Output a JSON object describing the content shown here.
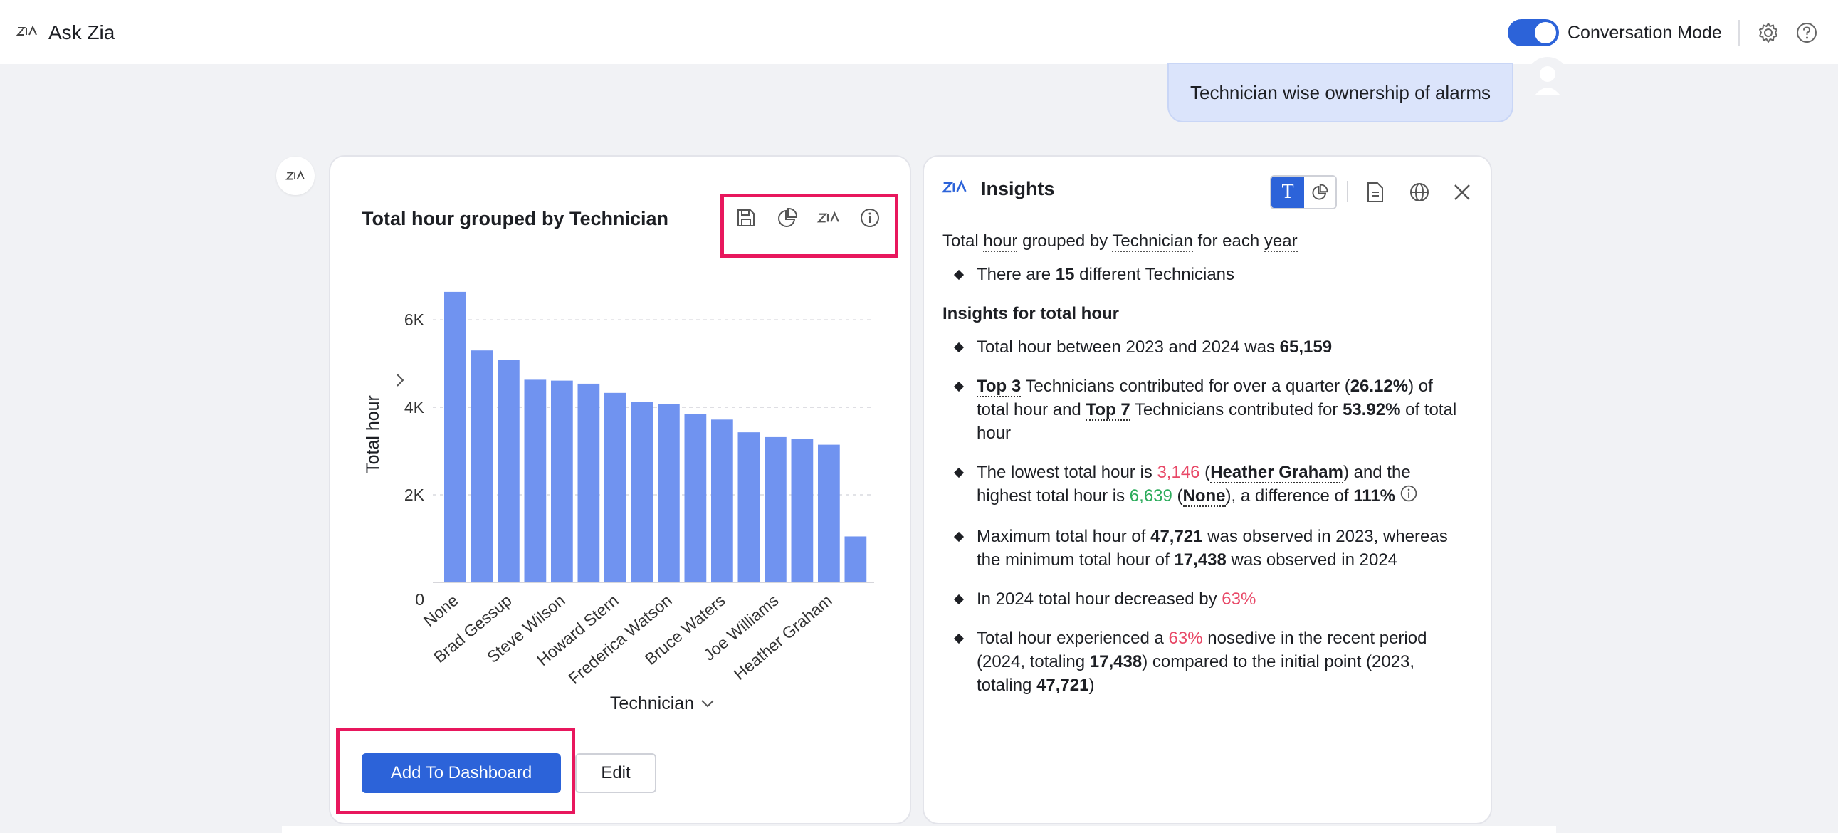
{
  "app": {
    "title": "Ask Zia",
    "mode_label": "Conversation Mode",
    "mode_on": true,
    "icons": {
      "brand": "zia-logo-icon",
      "settings": "gear-icon",
      "help": "help-icon"
    }
  },
  "conversation": {
    "user_message": "Technician wise ownership of alarms"
  },
  "chart_card": {
    "title": "Total hour grouped by Technician",
    "tools": [
      "save-icon",
      "pie-chart-icon",
      "zia-icon",
      "info-icon"
    ],
    "add_button": "Add To Dashboard",
    "edit_button": "Edit"
  },
  "chart_data": {
    "type": "bar",
    "xlabel": "Technician",
    "ylabel": "Total hour",
    "ylim": [
      0,
      6800
    ],
    "yticks": [
      0,
      2000,
      4000,
      6000
    ],
    "ytick_labels": [
      "0",
      "2K",
      "4K",
      "6K"
    ],
    "categories": [
      "None",
      "",
      "Brad Gessup",
      "",
      "Steve Wilson",
      "",
      "Howard Stern",
      "",
      "Frederica Watson",
      "",
      "Bruce Waters",
      "",
      "Joe Williams",
      "",
      "Heather Graham",
      ""
    ],
    "values": [
      6639,
      5300,
      5080,
      4630,
      4610,
      4540,
      4330,
      4120,
      4080,
      3850,
      3720,
      3430,
      3320,
      3270,
      3146,
      1050
    ],
    "color": "#7093f0"
  },
  "insights": {
    "title": "Insights",
    "summary": {
      "a": "Total ",
      "b": "hour",
      "c": " grouped by ",
      "d": "Technician",
      "e": " for each ",
      "f": "year"
    },
    "count": {
      "a": "There are ",
      "b": "15",
      "c": " different Technicians"
    },
    "section_title": "Insights for total hour",
    "b1": {
      "a": "Total hour between 2023 and 2024 was ",
      "b": "65,159"
    },
    "b2": {
      "a": "Top 3",
      "b": " Technicians contributed for over a quarter (",
      "c": "26.12%",
      "d": ") of total hour and ",
      "e": "Top 7",
      "f": " Technicians contributed for ",
      "g": "53.92%",
      "h": " of total hour"
    },
    "b3": {
      "a": "The lowest total hour is ",
      "b": "3,146",
      "c": " (",
      "d": "Heather Graham",
      "e": ") and the highest total hour is ",
      "f": "6,639",
      "g": " (",
      "h": "None",
      "i": "), a difference of ",
      "j": "111%"
    },
    "b4": {
      "a": "Maximum total hour of ",
      "b": "47,721",
      "c": " was observed in 2023, whereas the minimum total hour of ",
      "d": "17,438",
      "e": " was observed in 2024"
    },
    "b5": {
      "a": "In 2024 total hour decreased by ",
      "b": "63%"
    },
    "b6": {
      "a": "Total hour experienced a ",
      "b": "63%",
      "c": " nosedive in the recent period (2024, totaling ",
      "d": "17,438",
      "e": ") compared to the initial point (2023, totaling ",
      "f": "47,721",
      "g": ")"
    }
  }
}
